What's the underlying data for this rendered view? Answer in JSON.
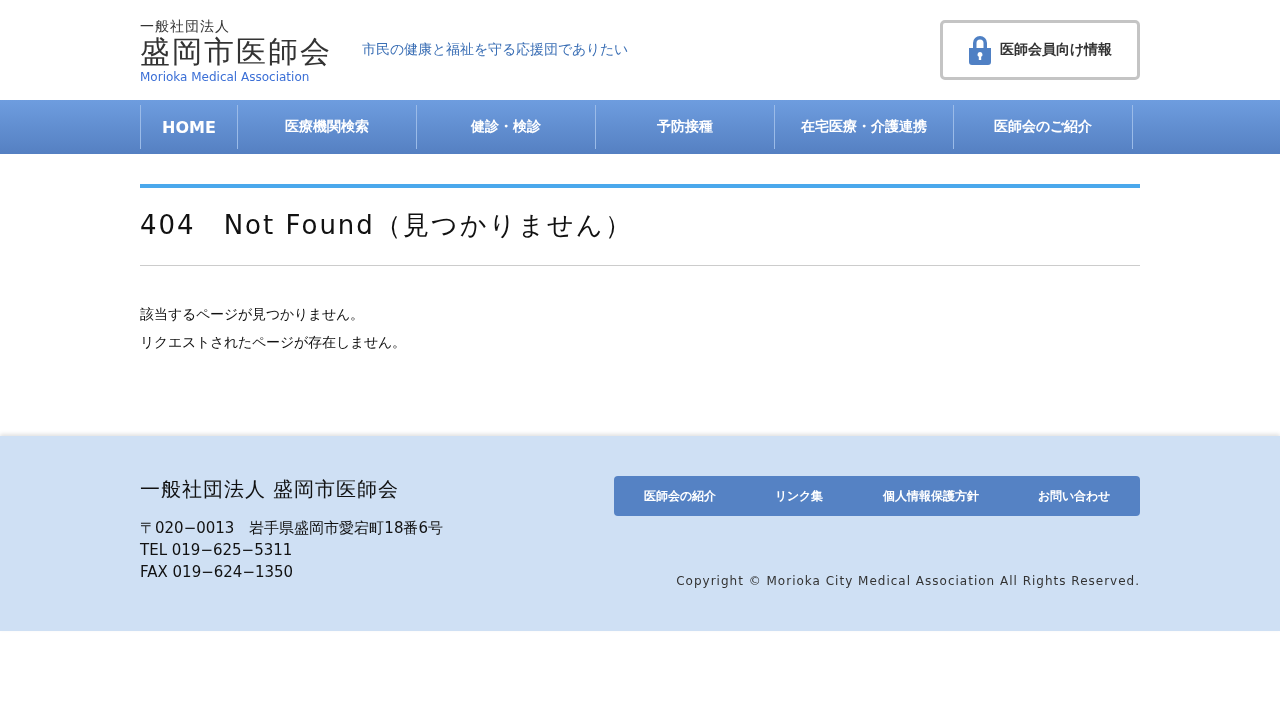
{
  "header": {
    "logo_top": "一般社団法人",
    "logo_main": "盛岡市医師会",
    "logo_en": "Morioka Medical Association",
    "tagline": "市民の健康と福祉を守る応援団でありたい",
    "member_button": "医師会員向け情報"
  },
  "nav": [
    {
      "label": "HOME",
      "kind": "en"
    },
    {
      "label": "医療機関検索",
      "kind": "ja"
    },
    {
      "label": "健診・検診",
      "kind": "ja"
    },
    {
      "label": "予防接種",
      "kind": "ja"
    },
    {
      "label": "在宅医療・介護連携",
      "kind": "ja"
    },
    {
      "label": "医師会のご紹介",
      "kind": "ja"
    }
  ],
  "main": {
    "title": "404　Not Found（見つかりません）",
    "lines": [
      "該当するページが見つかりません。",
      "リクエストされたページが存在しません。"
    ]
  },
  "footer": {
    "org": "一般社団法人 盛岡市医師会",
    "address": [
      "〒020−0013　岩手県盛岡市愛宕町18番6号",
      "TEL 019−625−5311",
      "FAX 019−624−1350"
    ],
    "links": [
      "医師会の紹介",
      "リンク集",
      "個人情報保護方針",
      "お問い合わせ"
    ],
    "copyright": "Copyright © Morioka City Medical Association All Rights Reserved."
  }
}
